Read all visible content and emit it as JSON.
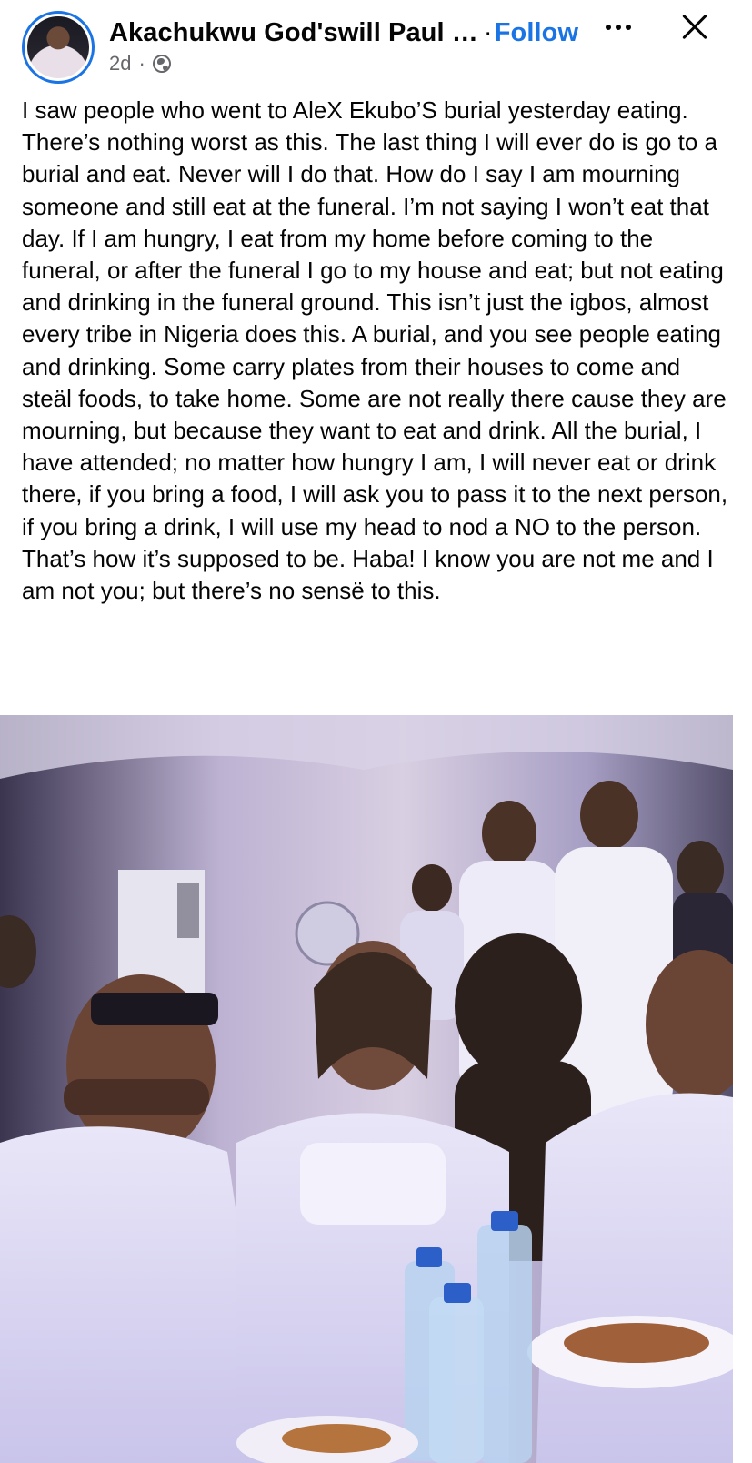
{
  "post": {
    "author": "Akachukwu God'swill Paul …",
    "separator": "·",
    "follow_label": "Follow",
    "time_ago": "2d",
    "time_separator": "·",
    "audience_icon": "globe-icon",
    "body": "I saw people who went to AleX Ekubo’S burial yesterday eating. There’s nothing worst as this. The last thing I will ever do is go to a burial and eat. Never will I do that. How do I say I am mourning someone and still eat at the funeral. I’m not saying I won’t eat that day. If I am hungry, I eat from my home before coming to the funeral, or after the funeral I go to my house and eat; but not eating and drinking in the funeral ground. This isn’t just the igbos, almost every tribe in Nigeria does this. A burial, and you see people eating and drinking. Some carry plates from their houses to come and steäl foods, to take home. Some are not really there cause they are mourning, but because they want to eat and drink. All the burial, I have attended; no matter how hungry I am, I will never eat or drink there, if you bring a food, I will ask you to pass it to the next person, if you bring a drink, I will use my head to nod a NO to the person. That’s how it’s supposed to be. Haba! I know you are not me and I am not you; but there’s no sensë to this."
  },
  "colors": {
    "accent": "#1b74e4",
    "text": "#050505",
    "secondary": "#65676b"
  },
  "icons": {
    "more": "more-horizontal-icon",
    "close": "close-icon"
  }
}
